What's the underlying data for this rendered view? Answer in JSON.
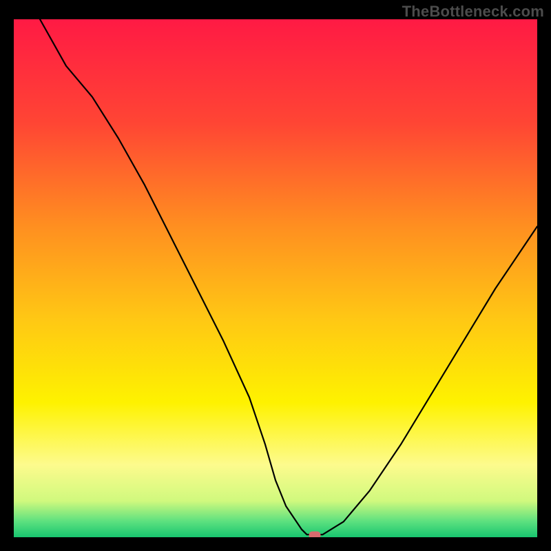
{
  "watermark": "TheBottleneck.com",
  "chart_data": {
    "type": "line",
    "title": "",
    "xlabel": "",
    "ylabel": "",
    "xlim": [
      0,
      100
    ],
    "ylim": [
      0,
      100
    ],
    "grid": false,
    "legend": false,
    "background_gradient_stops": [
      {
        "pos": 0.0,
        "color": "#ff1a44"
      },
      {
        "pos": 0.2,
        "color": "#ff4534"
      },
      {
        "pos": 0.4,
        "color": "#ff8f20"
      },
      {
        "pos": 0.58,
        "color": "#ffc814"
      },
      {
        "pos": 0.74,
        "color": "#fef200"
      },
      {
        "pos": 0.86,
        "color": "#fdfb8d"
      },
      {
        "pos": 0.93,
        "color": "#d0f97e"
      },
      {
        "pos": 0.97,
        "color": "#5be07f"
      },
      {
        "pos": 1.0,
        "color": "#18c56f"
      }
    ],
    "series": [
      {
        "name": "bottleneck-curve",
        "x": [
          5,
          10,
          15,
          20,
          25,
          30,
          35,
          40,
          45,
          48,
          50,
          52,
          55,
          56,
          59,
          63,
          68,
          74,
          80,
          86,
          92,
          100
        ],
        "y": [
          100,
          91,
          85,
          77,
          68,
          58,
          48,
          38,
          27,
          18,
          11,
          6,
          1.5,
          0.5,
          0.5,
          3,
          9,
          18,
          28,
          38,
          48,
          60
        ]
      }
    ],
    "marker": {
      "x": 57.5,
      "y": 0.4,
      "color": "#d96a6e"
    }
  }
}
